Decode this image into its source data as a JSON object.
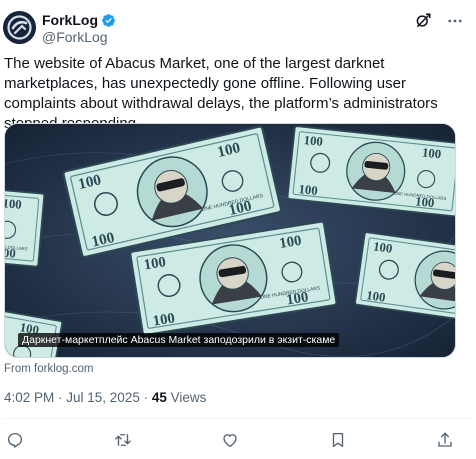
{
  "author": {
    "display_name": "ForkLog",
    "handle": "@ForkLog",
    "avatar_icon": "forklog-logo-icon",
    "verified_icon": "verified-badge-icon",
    "verified_color": "#1d9bf0"
  },
  "top_actions": {
    "grok_icon": "grok-icon",
    "more_icon": "more-options-icon"
  },
  "tweet": {
    "text": "The website of Abacus Market, one of the largest darknet marketplaces, has unexpectedly gone offline. Following user complaints about withdrawal delays, the platform’s administrators stopped responding."
  },
  "media": {
    "caption": "Даркнет-маркетплейс Abacus Market заподозрили в экзит-скаме",
    "image_icon": "masked-hundred-dollar-bills-illustration",
    "banknote_denomination": "100",
    "banknote_text": "ONE HUNDRED DOLLARS"
  },
  "card": {
    "source": "From forklog.com"
  },
  "meta": {
    "timestamp": "4:02 PM · Jul 15, 2025 · ",
    "views_count": "45",
    "views_label": " Views"
  },
  "actions": {
    "reply_icon": "reply-icon",
    "retweet_icon": "retweet-icon",
    "like_icon": "like-icon",
    "bookmark_icon": "bookmark-icon",
    "share_icon": "share-icon",
    "icon_color": "#536471"
  },
  "colors": {
    "text_primary": "#0f1419",
    "text_secondary": "#536471",
    "bill_green": "#c9e8e1",
    "bill_dark": "#2c4a55",
    "background_navy": "#1b2a3f"
  }
}
